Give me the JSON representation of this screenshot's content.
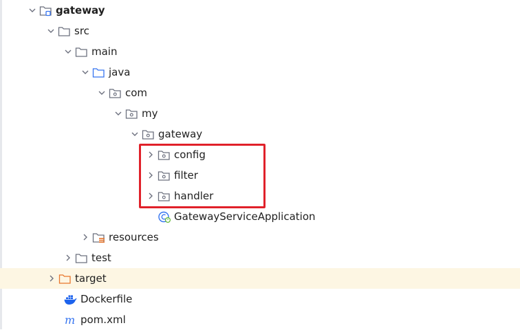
{
  "project_tree": {
    "highlight_color": "#fdf6e3",
    "annotation_color": "#e0212a",
    "nodes": [
      {
        "label": "gateway",
        "icon": "module-folder-icon",
        "expanded": true,
        "bold": true
      },
      {
        "label": "src",
        "icon": "folder-icon",
        "expanded": true
      },
      {
        "label": "main",
        "icon": "folder-icon",
        "expanded": true
      },
      {
        "label": "java",
        "icon": "source-folder-icon",
        "expanded": true
      },
      {
        "label": "com",
        "icon": "package-icon",
        "expanded": true
      },
      {
        "label": "my",
        "icon": "package-icon",
        "expanded": true
      },
      {
        "label": "gateway",
        "icon": "package-icon",
        "expanded": true
      },
      {
        "label": "config",
        "icon": "package-icon",
        "expanded": false
      },
      {
        "label": "filter",
        "icon": "package-icon",
        "expanded": false
      },
      {
        "label": "handler",
        "icon": "package-icon",
        "expanded": false
      },
      {
        "label": "GatewayServiceApplication",
        "icon": "spring-boot-class-icon"
      },
      {
        "label": "resources",
        "icon": "resources-folder-icon",
        "expanded": false
      },
      {
        "label": "test",
        "icon": "folder-icon",
        "expanded": false
      },
      {
        "label": "target",
        "icon": "excluded-folder-icon",
        "expanded": false,
        "highlighted": true
      },
      {
        "label": "Dockerfile",
        "icon": "docker-icon"
      },
      {
        "label": "pom.xml",
        "icon": "maven-icon"
      }
    ]
  }
}
